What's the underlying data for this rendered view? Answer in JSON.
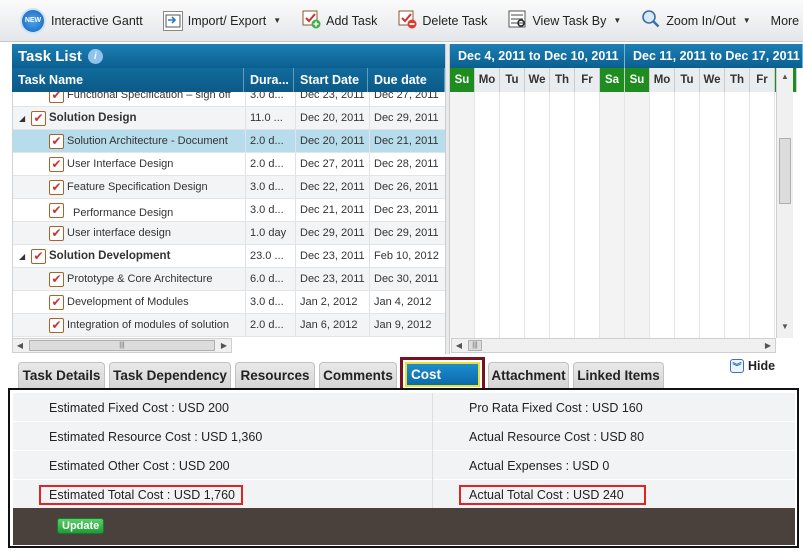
{
  "toolbar": {
    "new_badge": "NEW",
    "items": [
      {
        "label": "Interactive Gantt",
        "icon": "new-badge-icon",
        "caret": false
      },
      {
        "label": "Import/ Export",
        "icon": "import-export-icon",
        "caret": true
      },
      {
        "label": "Add Task",
        "icon": "add-task-icon",
        "caret": false
      },
      {
        "label": "Delete Task",
        "icon": "delete-task-icon",
        "caret": false
      },
      {
        "label": "View Task By",
        "icon": "view-task-icon",
        "caret": true
      },
      {
        "label": "Zoom In/Out",
        "icon": "zoom-icon",
        "caret": true
      },
      {
        "label": "More",
        "icon": "",
        "caret": true
      }
    ]
  },
  "task_list": {
    "title": "Task List",
    "columns": {
      "name": "Task Name",
      "duration": "Dura...",
      "start": "Start Date",
      "due": "Due date"
    },
    "rows": [
      {
        "name": "Functional Specification – sign off",
        "duration": "3.0 d...",
        "start": "Dec 23, 2011",
        "due": "Dec 27, 2011",
        "group": false
      },
      {
        "name": "Solution Design",
        "duration": "11.0 ...",
        "start": "Dec 20, 2011",
        "due": "Dec 29, 2011",
        "group": true
      },
      {
        "name": "Solution Architecture - Document",
        "duration": "2.0 d...",
        "start": "Dec 20, 2011",
        "due": "Dec 21, 2011",
        "group": false,
        "selected": true
      },
      {
        "name": "User Interface Design",
        "duration": "2.0 d...",
        "start": "Dec 27, 2011",
        "due": "Dec 28, 2011",
        "group": false
      },
      {
        "name": "Feature Specification Design",
        "duration": "3.0 d...",
        "start": "Dec 22, 2011",
        "due": "Dec 26, 2011",
        "group": false
      },
      {
        "name": "Performance Design",
        "duration": "3.0 d...",
        "start": "Dec 21, 2011",
        "due": "Dec 23, 2011",
        "group": false
      },
      {
        "name": "User interface design",
        "duration": "1.0 day",
        "start": "Dec 29, 2011",
        "due": "Dec 29, 2011",
        "group": false
      },
      {
        "name": "Solution Development",
        "duration": "23.0 ...",
        "start": "Dec 23, 2011",
        "due": "Feb 10, 2012",
        "group": true
      },
      {
        "name": "Prototype & Core Architecture",
        "duration": "6.0 d...",
        "start": "Dec 23, 2011",
        "due": "Dec 30, 2011",
        "group": false
      },
      {
        "name": "Development of Modules",
        "duration": "3.0 d...",
        "start": "Jan 2, 2012",
        "due": "Jan 4, 2012",
        "group": false
      },
      {
        "name": "Integration of modules of solution",
        "duration": "2.0 d...",
        "start": "Jan 6, 2012",
        "due": "Jan 9, 2012",
        "group": false
      }
    ]
  },
  "gantt": {
    "weeks": [
      "Dec 4, 2011 to Dec 10, 2011",
      "Dec 11, 2011 to Dec 17, 2011"
    ],
    "days": [
      "Su",
      "Mo",
      "Tu",
      "We",
      "Th",
      "Fr",
      "Sa",
      "Su",
      "Mo",
      "Tu",
      "We",
      "Th",
      "Fr",
      "Sa"
    ]
  },
  "tabs": [
    {
      "label": "Task Details"
    },
    {
      "label": "Task Dependency"
    },
    {
      "label": "Resources"
    },
    {
      "label": "Comments"
    },
    {
      "label": "Cost",
      "active": true
    },
    {
      "label": "Attachment"
    },
    {
      "label": "Linked Items"
    }
  ],
  "hide_label": "Hide",
  "cost": {
    "rows": [
      {
        "left": "Estimated Fixed Cost : USD 200",
        "right": "Pro Rata Fixed Cost : USD 160"
      },
      {
        "left": "Estimated Resource Cost : USD 1,360",
        "right": "Actual Resource Cost : USD 80"
      },
      {
        "left": "Estimated Other Cost : USD 200",
        "right": "Actual Expenses : USD 0"
      },
      {
        "left": "Estimated Total Cost : USD 1,760",
        "right": "Actual Total Cost : USD 240",
        "highlight": true
      }
    ],
    "update_label": "Update"
  },
  "colors": {
    "header_blue": "#0b5f90",
    "weekend_green": "#1e8c1e",
    "selected_row": "#b7dceb",
    "highlight_red": "#e02424",
    "footer_brown": "#4a413c",
    "update_green": "#1f9b34"
  }
}
